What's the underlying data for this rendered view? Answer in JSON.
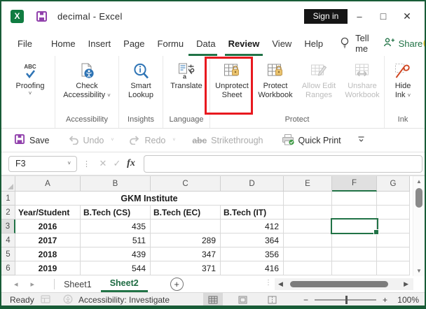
{
  "window": {
    "title": "decimal - Excel",
    "sign_in_label": "Sign in"
  },
  "menu": {
    "tabs": [
      "File",
      "Home",
      "Insert",
      "Page",
      "Formu",
      "Data",
      "Review",
      "View",
      "Help"
    ],
    "active_tab": "Review",
    "tell_me": "Tell me",
    "share": "Share"
  },
  "ribbon": {
    "proofing": {
      "label": "Proofing"
    },
    "check_accessibility": {
      "line1": "Check",
      "line2": "Accessibility"
    },
    "smart_lookup": {
      "line1": "Smart",
      "line2": "Lookup"
    },
    "translate": {
      "label": "Translate"
    },
    "unprotect_sheet": {
      "line1": "Unprotect",
      "line2": "Sheet"
    },
    "protect_workbook": {
      "line1": "Protect",
      "line2": "Workbook"
    },
    "allow_edit_ranges": {
      "line1": "Allow Edit",
      "line2": "Ranges"
    },
    "unshare_workbook": {
      "line1": "Unshare",
      "line2": "Workbook"
    },
    "hide_ink": {
      "line1": "Hide",
      "line2": "Ink"
    },
    "group_labels": {
      "accessibility": "Accessibility",
      "insights": "Insights",
      "language": "Language",
      "protect": "Protect",
      "ink": "Ink"
    }
  },
  "qat": {
    "save": "Save",
    "undo": "Undo",
    "redo": "Redo",
    "strike_icon_text": "abc",
    "strikethrough": "Strikethrough",
    "quick_print": "Quick Print"
  },
  "formula_bar": {
    "name_box": "F3",
    "fx": "fx",
    "formula": ""
  },
  "grid": {
    "columns": [
      "A",
      "B",
      "C",
      "D",
      "E",
      "F",
      "G"
    ],
    "row_numbers": [
      "1",
      "2",
      "3",
      "4",
      "5",
      "6"
    ],
    "title_row": "GKM Institute",
    "rows": {
      "r2": [
        "Year/Student",
        "B.Tech (CS)",
        "B.Tech (EC)",
        "B.Tech (IT)"
      ],
      "r3": [
        "2016",
        "435",
        "",
        "412"
      ],
      "r4": [
        "2017",
        "511",
        "289",
        "364"
      ],
      "r5": [
        "2018",
        "439",
        "347",
        "356"
      ],
      "r6": [
        "2019",
        "544",
        "371",
        "416"
      ]
    },
    "selected_cell": "F3",
    "selected_column": "F",
    "selected_row": "3"
  },
  "sheet_bar": {
    "tabs": [
      "Sheet1",
      "Sheet2"
    ],
    "active_tab": "Sheet2"
  },
  "status_bar": {
    "ready": "Ready",
    "accessibility": "Accessibility: Investigate",
    "zoom_level": "100%"
  },
  "colors": {
    "excel_green": "#217346",
    "window_border": "#185c37",
    "highlight_red": "#e8191f",
    "lock_gold": "#e6bd6a",
    "icon_blue": "#2e74b5",
    "save_purple": "#9141ac",
    "ink_red": "#cf4520",
    "smiley_yellow": "#fdc92d",
    "sign_in_bg": "#151515"
  },
  "glyphs": {
    "excel_logo_letter": "X",
    "minimize": "–",
    "maximize": "□",
    "close": "✕",
    "chevron_down": "˅",
    "dots_separator": "⋮",
    "cancel": "✕",
    "check": "✓",
    "tab_scroll_left": "◂",
    "tab_scroll_right": "▸",
    "hscroll_left": "◀",
    "hscroll_right": "▶",
    "vscroll_up": "▲",
    "vscroll_down": "▼",
    "add_sheet": "+",
    "zoom_out": "−",
    "zoom_in": "+"
  }
}
